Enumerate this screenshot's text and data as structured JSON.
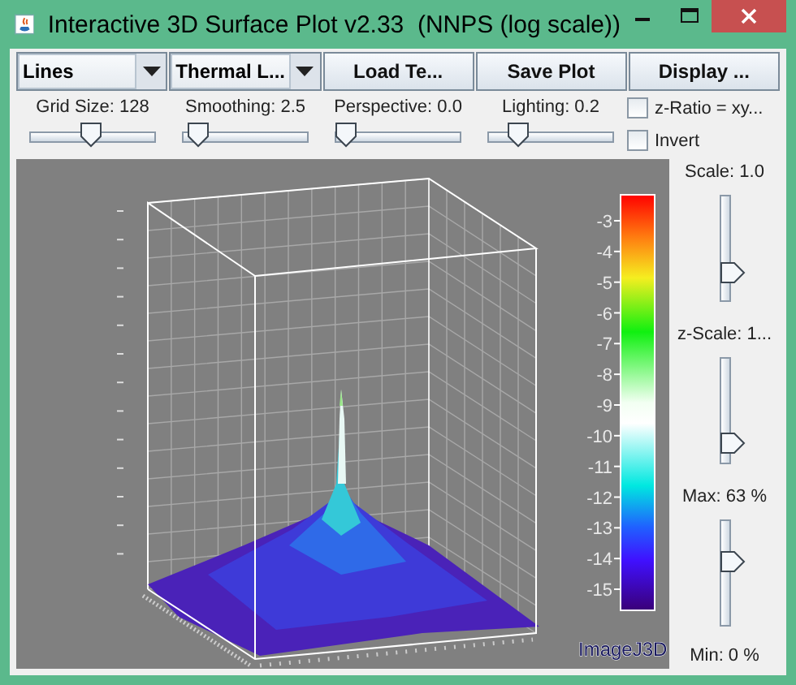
{
  "window": {
    "title": "Interactive 3D Surface Plot v2.33  (NNPS (log scale))"
  },
  "toolbar": [
    {
      "kind": "dropdown",
      "label": "Lines"
    },
    {
      "kind": "dropdown",
      "label": "Thermal L..."
    },
    {
      "kind": "button",
      "label": "Load Te..."
    },
    {
      "kind": "button",
      "label": "Save Plot"
    },
    {
      "kind": "button",
      "label": "Display ..."
    }
  ],
  "sliders": [
    {
      "label": "Grid Size: 128",
      "level": 0.48
    },
    {
      "label": "Smoothing: 2.5",
      "level": 0.04
    },
    {
      "label": "Perspective: 0.0",
      "level": 0.0
    },
    {
      "label": "Lighting: 0.2",
      "level": 0.18
    }
  ],
  "checkboxes": [
    {
      "label": "z-Ratio = xy...",
      "checked": false
    },
    {
      "label": "Invert",
      "checked": false
    }
  ],
  "color_bar": {
    "labels": [
      "-3",
      "-4",
      "-5",
      "-6",
      "-7",
      "-8",
      "-9",
      "-10",
      "-11",
      "-12",
      "-13",
      "-14",
      "-15"
    ]
  },
  "plot_caption": "ImageJ3D",
  "side_sliders": [
    {
      "label": "Scale: 1.0",
      "level": 0.22
    },
    {
      "label": "z-Scale: 1...",
      "level": 0.12
    },
    {
      "label": "Max: 63 %",
      "level": 0.63
    }
  ],
  "min_label": "Min: 0 %"
}
